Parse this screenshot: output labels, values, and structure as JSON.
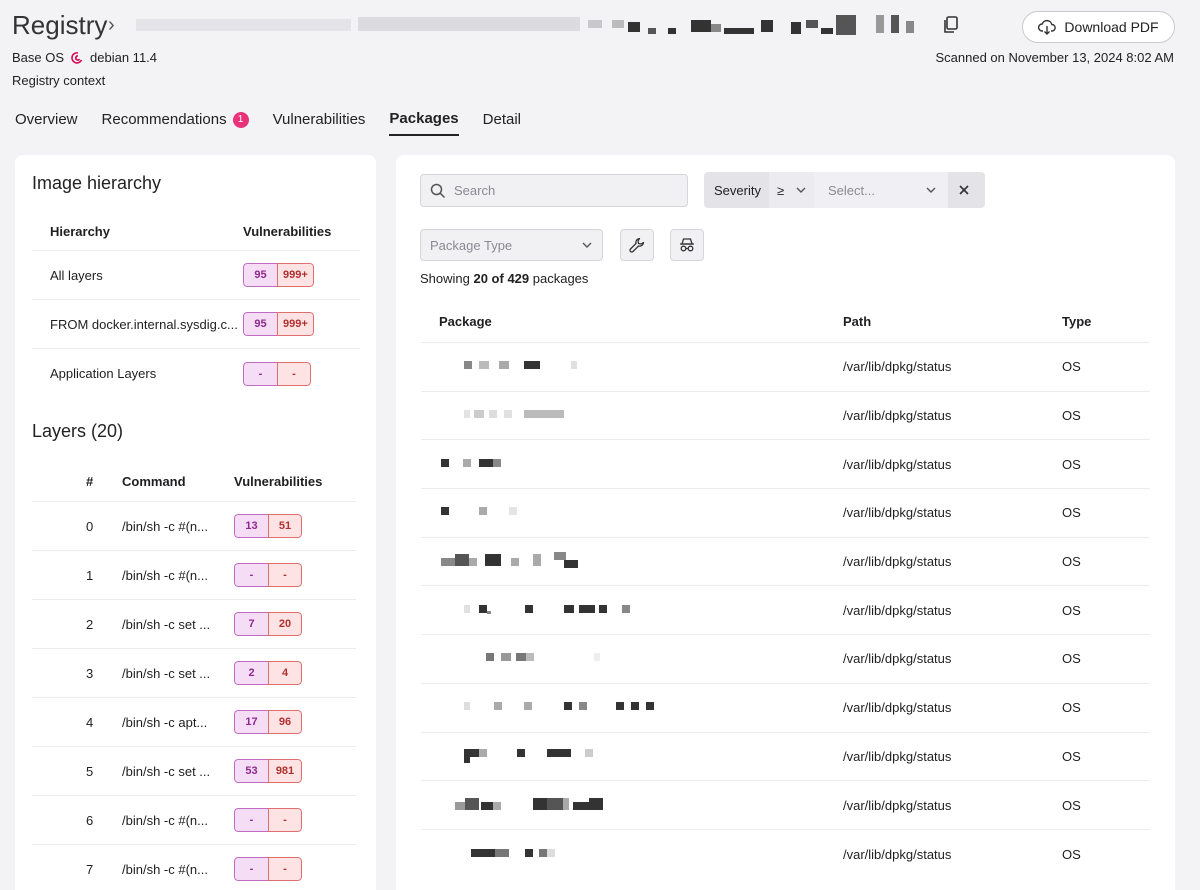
{
  "header": {
    "title": "Registry",
    "download_label": "Download PDF",
    "base_os_label": "Base OS",
    "base_os_value": "debian 11.4",
    "registry_context": "Registry context",
    "scanned": "Scanned on November 13, 2024 8:02 AM"
  },
  "tabs": [
    {
      "label": "Overview"
    },
    {
      "label": "Recommendations",
      "badge": "1"
    },
    {
      "label": "Vulnerabilities"
    },
    {
      "label": "Packages",
      "active": true
    },
    {
      "label": "Detail"
    }
  ],
  "image_hierarchy": {
    "title": "Image hierarchy",
    "col_hierarchy": "Hierarchy",
    "col_vulns": "Vulnerabilities",
    "rows": [
      {
        "name": "All layers",
        "a": "95",
        "b": "999+"
      },
      {
        "name": "FROM docker.internal.sysdig.c...",
        "a": "95",
        "b": "999+"
      },
      {
        "name": "Application Layers",
        "a": "-",
        "b": "-"
      }
    ]
  },
  "layers": {
    "title": "Layers (20)",
    "col_num": "#",
    "col_command": "Command",
    "col_vulns": "Vulnerabilities",
    "rows": [
      {
        "n": "0",
        "cmd": "/bin/sh -c #(n...",
        "a": "13",
        "b": "51"
      },
      {
        "n": "1",
        "cmd": "/bin/sh -c #(n...",
        "a": "-",
        "b": "-"
      },
      {
        "n": "2",
        "cmd": "/bin/sh -c set ...",
        "a": "7",
        "b": "20"
      },
      {
        "n": "3",
        "cmd": "/bin/sh -c set ...",
        "a": "2",
        "b": "4"
      },
      {
        "n": "4",
        "cmd": "/bin/sh -c apt...",
        "a": "17",
        "b": "96"
      },
      {
        "n": "5",
        "cmd": "/bin/sh -c set ...",
        "a": "53",
        "b": "981"
      },
      {
        "n": "6",
        "cmd": "/bin/sh -c #(n...",
        "a": "-",
        "b": "-"
      },
      {
        "n": "7",
        "cmd": "/bin/sh -c #(n...",
        "a": "-",
        "b": "-"
      }
    ]
  },
  "packages": {
    "search_placeholder": "Search",
    "severity_label": "Severity",
    "severity_op": "≥",
    "severity_placeholder": "Select...",
    "package_type_placeholder": "Package Type",
    "showing_prefix": "Showing ",
    "showing_count": "20 of 429",
    "showing_suffix": " packages",
    "col_package": "Package",
    "col_path": "Path",
    "col_type": "Type",
    "rows": [
      {
        "path": "/var/lib/dpkg/status",
        "type": "OS"
      },
      {
        "path": "/var/lib/dpkg/status",
        "type": "OS"
      },
      {
        "path": "/var/lib/dpkg/status",
        "type": "OS"
      },
      {
        "path": "/var/lib/dpkg/status",
        "type": "OS"
      },
      {
        "path": "/var/lib/dpkg/status",
        "type": "OS"
      },
      {
        "path": "/var/lib/dpkg/status",
        "type": "OS"
      },
      {
        "path": "/var/lib/dpkg/status",
        "type": "OS"
      },
      {
        "path": "/var/lib/dpkg/status",
        "type": "OS"
      },
      {
        "path": "/var/lib/dpkg/status",
        "type": "OS"
      },
      {
        "path": "/var/lib/dpkg/status",
        "type": "OS"
      },
      {
        "path": "/var/lib/dpkg/status",
        "type": "OS"
      }
    ]
  }
}
